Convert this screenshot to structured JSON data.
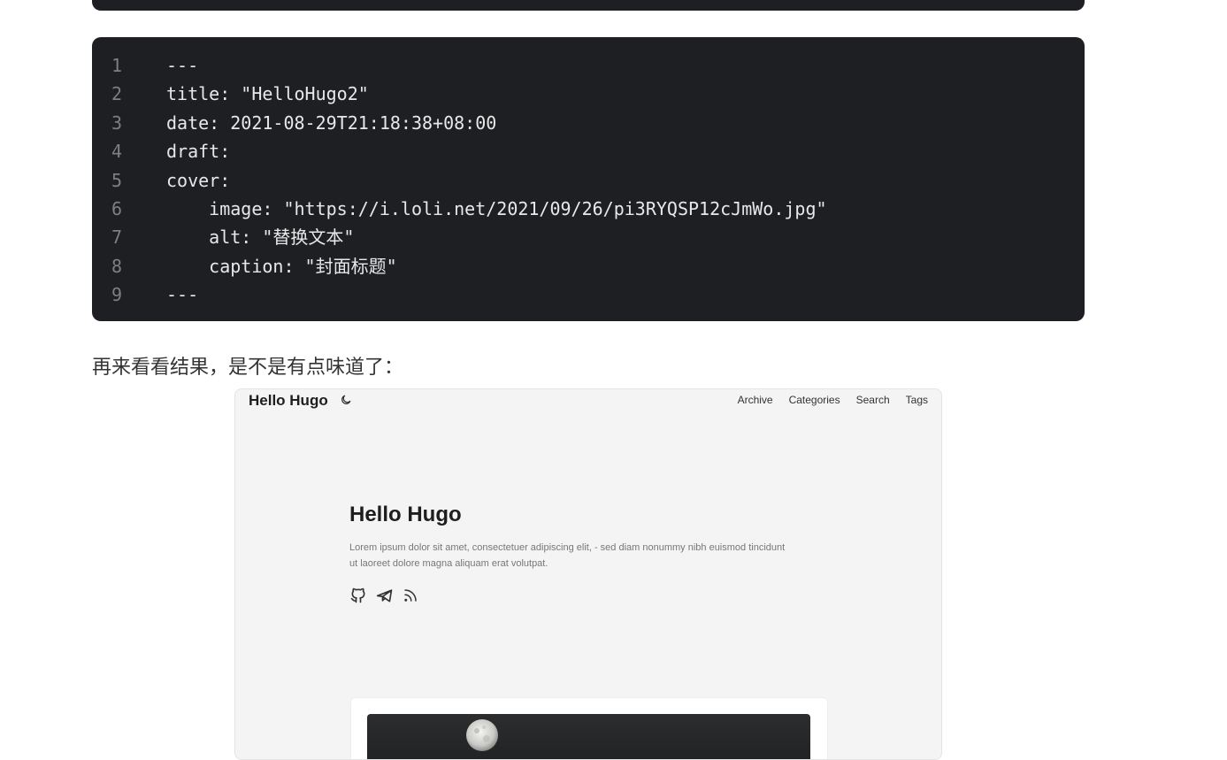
{
  "code_block": {
    "lines": [
      {
        "num": "1",
        "text": "---"
      },
      {
        "num": "2",
        "text": "title: \"HelloHugo2\""
      },
      {
        "num": "3",
        "text": "date: 2021-08-29T21:18:38+08:00"
      },
      {
        "num": "4",
        "text": "draft:"
      },
      {
        "num": "5",
        "text": "cover:"
      },
      {
        "num": "6",
        "text": "    image: \"https://i.loli.net/2021/09/26/pi3RYQSP12cJmWo.jpg\""
      },
      {
        "num": "7",
        "text": "    alt: \"替换文本\""
      },
      {
        "num": "8",
        "text": "    caption: \"封面标题\""
      },
      {
        "num": "9",
        "text": "---"
      }
    ]
  },
  "paragraph": "再来看看结果，是不是有点味道了：",
  "screenshot": {
    "logo": "Hello Hugo",
    "nav": [
      "Archive",
      "Categories",
      "Search",
      "Tags"
    ],
    "hero_title": "Hello Hugo",
    "hero_desc": "Lorem ipsum dolor sit amet, consectetuer adipiscing elit, - sed diam nonummy nibh euismod tincidunt ut laoreet dolore magna aliquam erat volutpat.",
    "social_icons": [
      "github-icon",
      "telegram-icon",
      "rss-icon"
    ],
    "theme_icon": "moon-icon"
  }
}
